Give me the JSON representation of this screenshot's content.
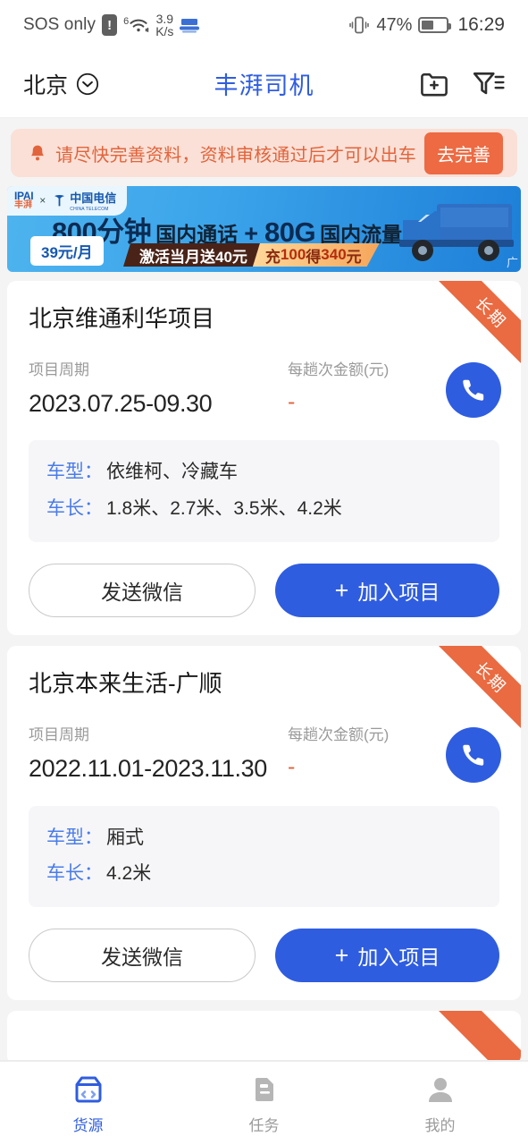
{
  "status_bar": {
    "carrier": "SOS only",
    "signal_gen": "6",
    "net_speed_value": "3.9",
    "net_speed_unit": "K/s",
    "battery_percent": "47%",
    "time": "16:29",
    "icons": [
      "alert-badge-icon",
      "wifi-icon",
      "vpn-icon",
      "vibrate-icon",
      "battery-icon"
    ]
  },
  "header": {
    "city": "北京",
    "title": "丰湃司机",
    "actions": [
      "folder-plus-icon",
      "filter-icon"
    ]
  },
  "alert": {
    "message": "请尽快完善资料，资料审核通过后才可以出车",
    "action_label": "去完善"
  },
  "ad": {
    "brand_left": "IPAI",
    "brand_left_sub": "丰湃",
    "separator": "×",
    "brand_right": "中国电信",
    "brand_right_sub": "CHINA TELECOM",
    "headline_minutes": "800分钟",
    "headline_minutes_desc": "国内通话",
    "headline_plus": "+",
    "headline_data": "80G",
    "headline_data_desc": "国内流量",
    "promo_1": "激活当月送40元",
    "promo_2_prefix": "充",
    "promo_2_amount": "100",
    "promo_2_middle": "得",
    "promo_2_total": "340",
    "promo_2_suffix": "元",
    "price": "39元/月",
    "ad_mark": "广"
  },
  "cards": [
    {
      "ribbon": "长期",
      "title": "北京维通利华项目",
      "period_label": "项目周期",
      "period_value": "2023.07.25-09.30",
      "amount_label": "每趟次金额(元)",
      "amount_value": "-",
      "spec": [
        {
          "key": "车型：",
          "value": "依维柯、冷藏车"
        },
        {
          "key": "车长：",
          "value": "1.8米、2.7米、3.5米、4.2米"
        }
      ],
      "secondary_button": "发送微信",
      "primary_button": "加入项目",
      "primary_button_plus": "+",
      "call_icon": "phone-icon"
    },
    {
      "ribbon": "长期",
      "title": "北京本来生活-广顺",
      "period_label": "项目周期",
      "period_value": "2022.11.01-2023.11.30",
      "amount_label": "每趟次金额(元)",
      "amount_value": "-",
      "spec": [
        {
          "key": "车型：",
          "value": "厢式"
        },
        {
          "key": "车长：",
          "value": "4.2米"
        }
      ],
      "secondary_button": "发送微信",
      "primary_button": "加入项目",
      "primary_button_plus": "+",
      "call_icon": "phone-icon"
    }
  ],
  "tabbar": {
    "items": [
      {
        "label": "货源",
        "icon": "cargo-box-icon",
        "active": true
      },
      {
        "label": "任务",
        "icon": "task-document-icon",
        "active": false
      },
      {
        "label": "我的",
        "icon": "user-profile-icon",
        "active": false
      }
    ]
  },
  "colors": {
    "brand_blue": "#2f5de0",
    "alert_bg": "#fae0d6",
    "alert_text": "#e2643c",
    "alert_button": "#ed6a42",
    "ribbon": "#ea6a41",
    "page_bg": "#f4f4f4",
    "spec_bg": "#f6f6f8",
    "muted_text": "#9a9a9a"
  }
}
